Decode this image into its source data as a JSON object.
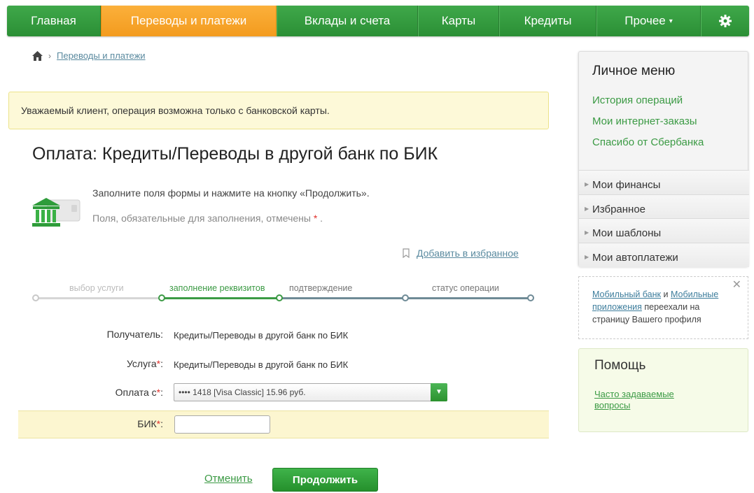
{
  "nav": {
    "items": [
      {
        "label": "Главная"
      },
      {
        "label": "Переводы и платежи"
      },
      {
        "label": "Вклады и счета"
      },
      {
        "label": "Карты"
      },
      {
        "label": "Кредиты"
      },
      {
        "label": "Прочее"
      }
    ]
  },
  "breadcrumb": {
    "link": "Переводы и платежи"
  },
  "notice": "Уважаемый клиент, операция возможна только с банковской карты.",
  "page_title": "Оплата: Кредиты/Переводы в другой банк по БИК",
  "form": {
    "hint": "Заполните поля формы и нажмите на кнопку «Продолжить».",
    "required_note": "Поля, обязательные для заполнения, отмечены",
    "required_mark": "*",
    "required_dot": ".",
    "add_favorite": "Добавить в избранное"
  },
  "steps": [
    {
      "label": "выбор услуги",
      "state": "done"
    },
    {
      "label": "заполнение реквизитов",
      "state": "current"
    },
    {
      "label": "подтверждение",
      "state": "pending"
    },
    {
      "label": "статус операции",
      "state": "pending"
    }
  ],
  "fields": {
    "recipient_label": "Получатель:",
    "recipient_value": "Кредиты/Переводы в другой банк по БИК",
    "service_label": "Услуга",
    "service_value": "Кредиты/Переводы в другой банк по БИК",
    "pay_from_label": "Оплата с",
    "pay_from_value": "•••• 1418  [Visa Classic] 15.96 руб.",
    "bik_label": "БИК",
    "bik_value": "",
    "star": "*",
    "colon": ":"
  },
  "actions": {
    "cancel": "Отменить",
    "continue": "Продолжить"
  },
  "sidebar": {
    "title": "Личное меню",
    "links": [
      "История операций",
      "Мои интернет-заказы",
      "Спасибо от Сбербанка"
    ],
    "sections": [
      "Мои финансы",
      "Избранное",
      "Мои шаблоны",
      "Мои автоплатежи"
    ]
  },
  "mobile": {
    "link1": "Мобильный банк",
    "and": "и",
    "link2": "Мобильные приложения",
    "rest": "переехали на страницу Вашего профиля"
  },
  "help": {
    "title": "Помощь",
    "link": "Часто задаваемые вопросы"
  },
  "colors": {
    "green": "#2b8f35",
    "orange": "#f39b1e",
    "notice_bg": "#fdf9d8"
  }
}
